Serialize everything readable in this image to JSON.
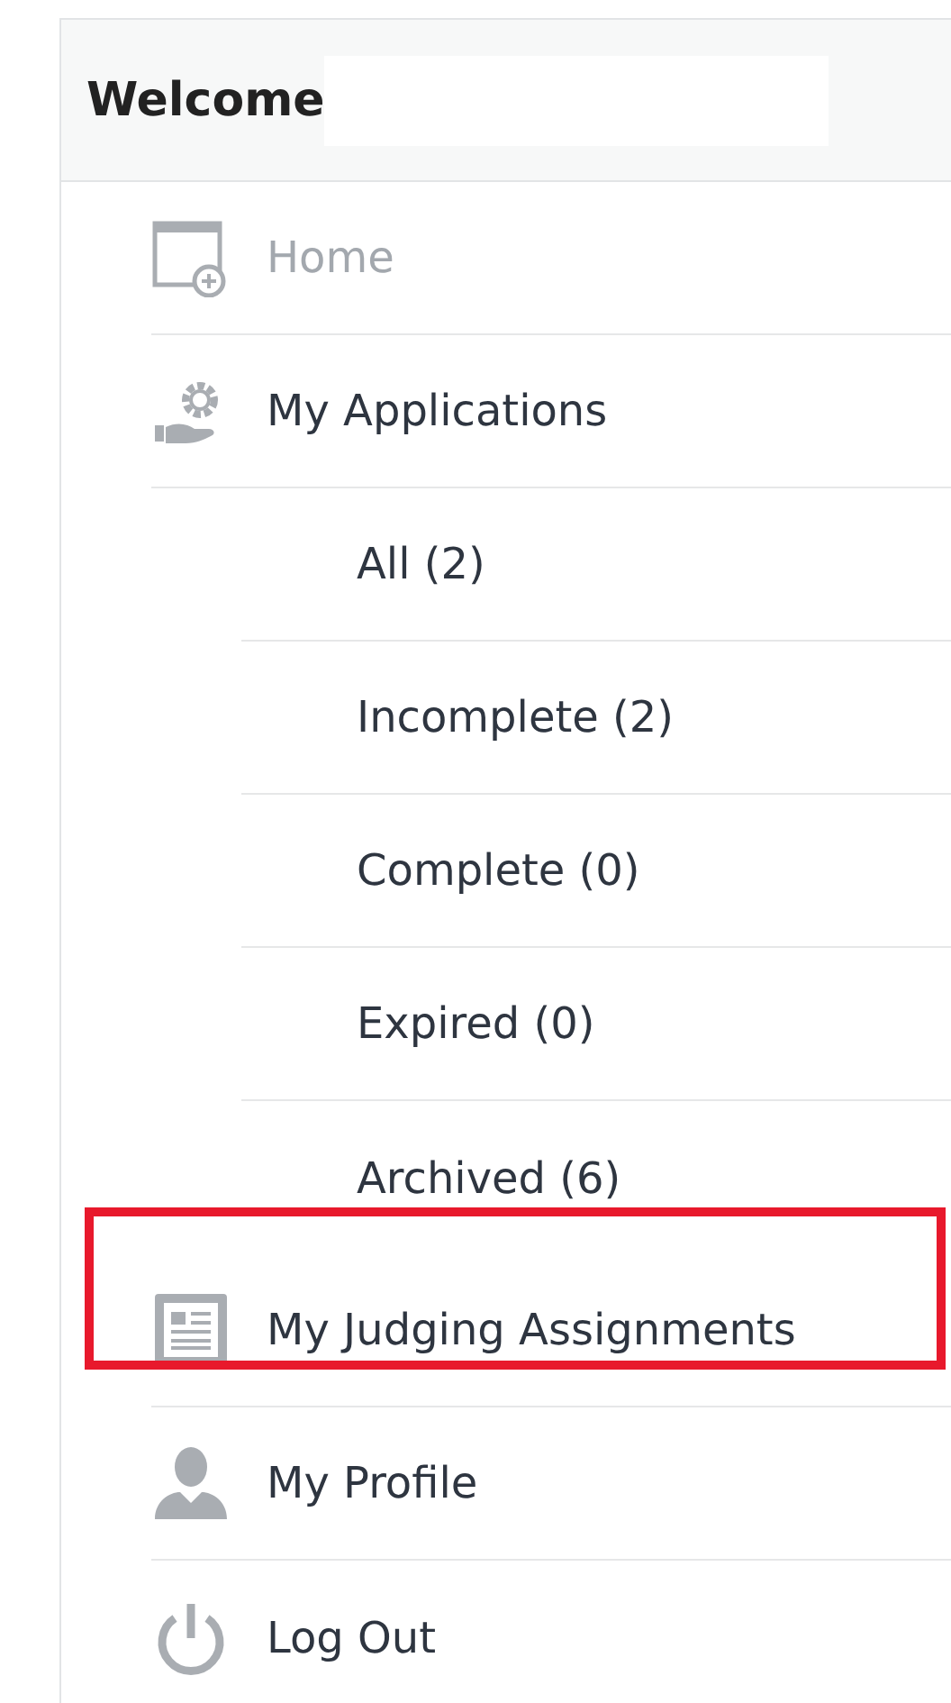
{
  "header": {
    "title": "Welcome"
  },
  "nav": {
    "items": [
      {
        "label": "Home",
        "selected": true,
        "highlighted": false
      },
      {
        "label": "My Applications",
        "selected": false,
        "highlighted": false,
        "children": [
          {
            "label": "All (2)",
            "selected": false
          },
          {
            "label": "Incomplete (2)",
            "selected": false
          },
          {
            "label": "Complete (0)",
            "selected": false
          },
          {
            "label": "Expired (0)",
            "selected": false
          },
          {
            "label": "Archived (6)",
            "selected": false
          }
        ]
      },
      {
        "label": "My Judging Assignments",
        "selected": false,
        "highlighted": true
      },
      {
        "label": "My Profile",
        "selected": false,
        "highlighted": false
      },
      {
        "label": "Log Out",
        "selected": false,
        "highlighted": false
      }
    ]
  }
}
